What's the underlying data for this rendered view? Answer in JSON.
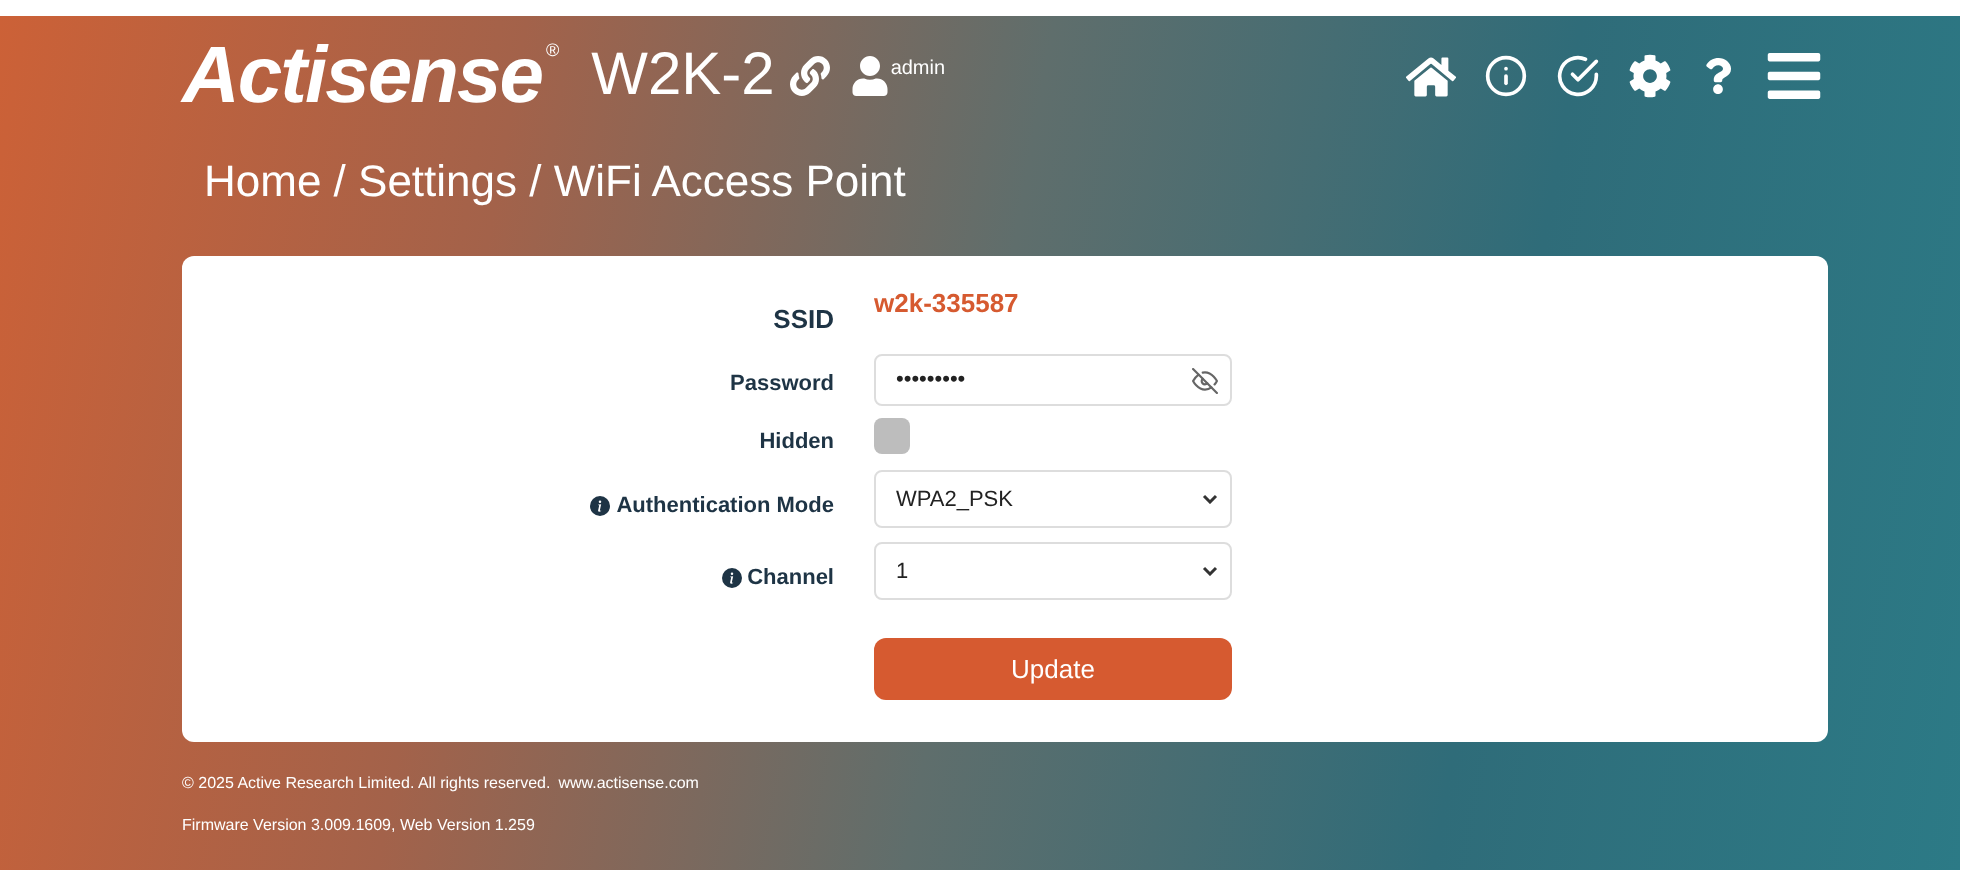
{
  "header": {
    "brand": "Actisense",
    "registered": "®",
    "device": "W2K-2",
    "user": "admin"
  },
  "breadcrumb": "Home / Settings / WiFi Access Point",
  "fields": [
    {
      "kind": "text",
      "label": "SSID",
      "info": false,
      "value": "w2k-335587"
    },
    {
      "kind": "password",
      "label": "Password",
      "info": false,
      "value": "•••••••••",
      "revealed": false
    },
    {
      "kind": "checkbox",
      "label": "Hidden",
      "info": false,
      "checked": false
    },
    {
      "kind": "select",
      "label": "Authentication Mode",
      "info": true,
      "value": "WPA2_PSK"
    },
    {
      "kind": "select",
      "label": "Channel",
      "info": true,
      "value": "1"
    }
  ],
  "button": "Update",
  "footer": {
    "copyright": "© 2025 Active Research Limited. All rights reserved.",
    "link": "www.actisense.com",
    "version": "Firmware Version 3.009.1609, Web Version 1.259"
  }
}
